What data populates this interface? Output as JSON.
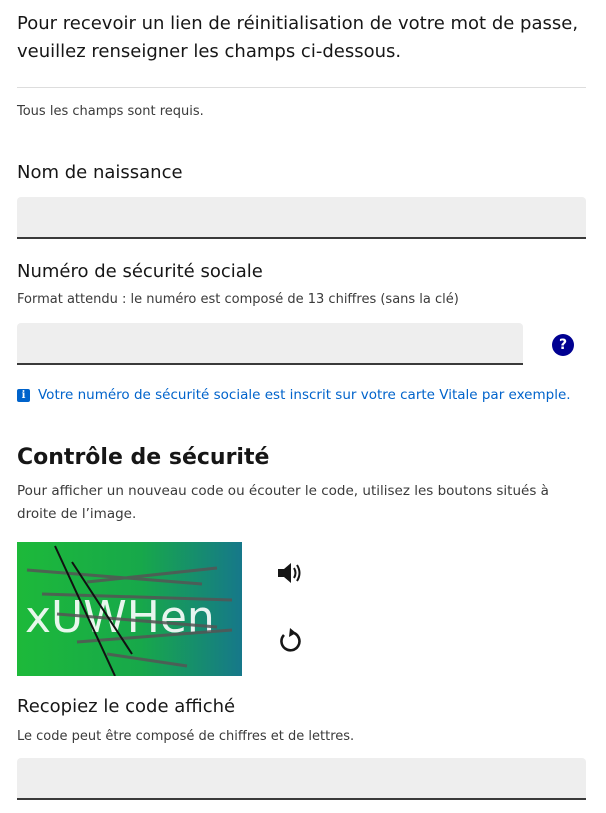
{
  "intro_text": "Pour recevoir un lien de réinitialisation de votre mot de passe, veuillez renseigner les champs ci-dessous.",
  "required_note": "Tous les champs sont requis.",
  "birth_name": {
    "label": "Nom de naissance",
    "value": ""
  },
  "ssn": {
    "label": "Numéro de sécurité sociale",
    "hint": "Format attendu : le numéro est composé de 13 chiffres (sans la clé)",
    "value": "",
    "help_glyph": "?",
    "info_text": "Votre numéro de sécurité sociale est inscrit sur votre carte Vitale par exemple."
  },
  "security": {
    "title": "Contrôle de sécurité",
    "hint": "Pour afficher un nouveau code ou écouter le code, utilisez les boutons situés à droite de l’image.",
    "captcha_code": "xUWHen",
    "audio_icon": "speaker-icon",
    "refresh_icon": "refresh-icon"
  },
  "code_field": {
    "label": "Recopiez le code affiché",
    "hint": "Le code peut être composé de chiffres et de lettres.",
    "value": ""
  },
  "colors": {
    "accent": "#000091",
    "info": "#0063cb",
    "input_bg": "#eeeeee"
  }
}
